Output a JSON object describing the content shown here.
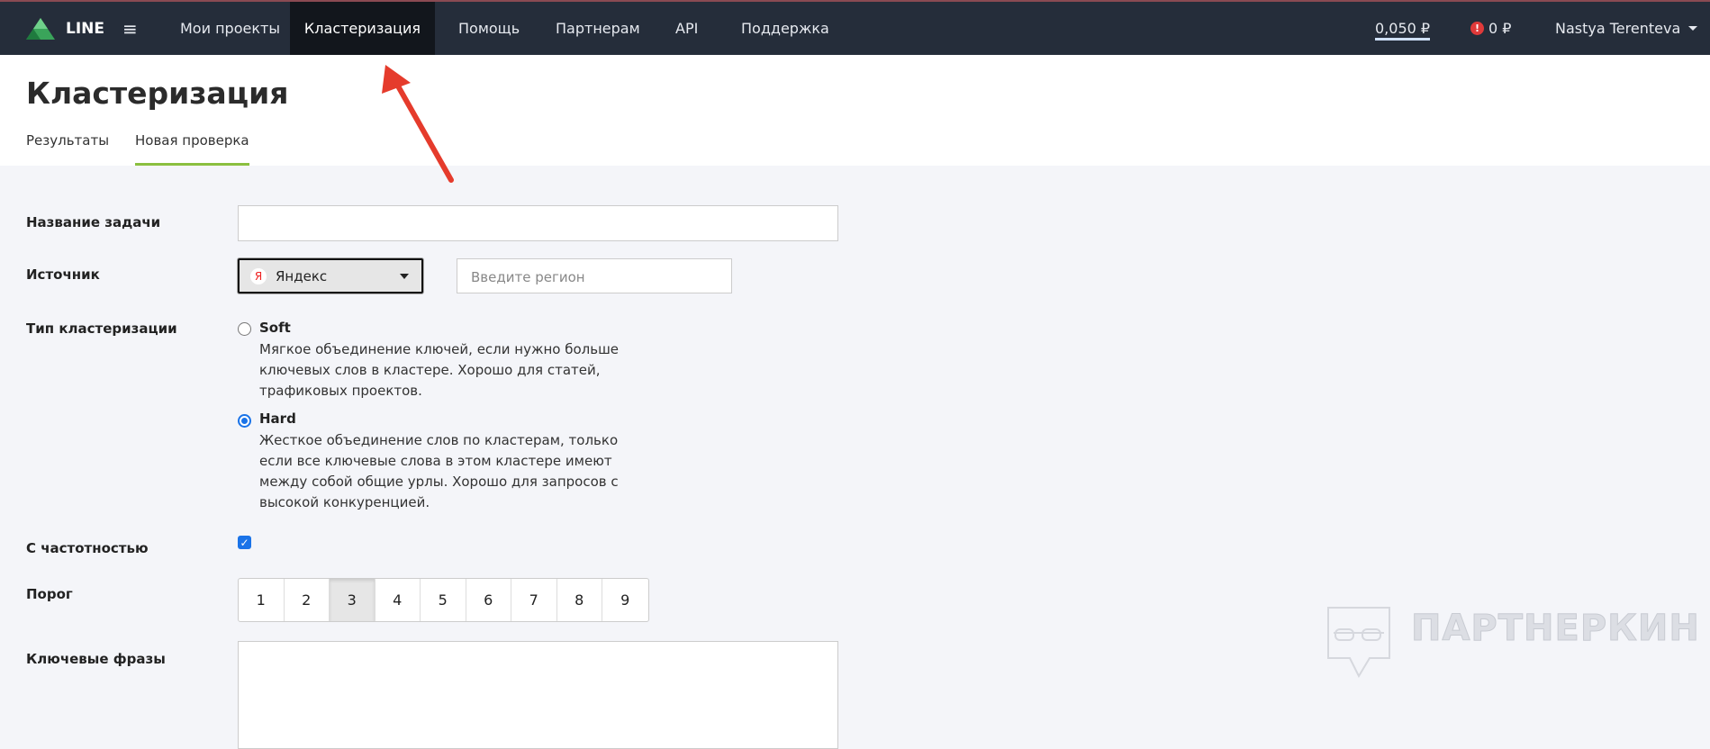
{
  "nav": {
    "logo": "LINE",
    "items": [
      "Мои проекты",
      "Кластеризация",
      "Помощь",
      "Партнерам",
      "API",
      "Поддержка"
    ],
    "active": "Кластеризация",
    "balance": "0,050 ₽",
    "debt": "0 ₽",
    "user": "Nastya Terenteva"
  },
  "page": {
    "title": "Кластеризация",
    "tabs": [
      "Результаты",
      "Новая проверка"
    ],
    "active_tab": "Новая проверка"
  },
  "form": {
    "task_name_label": "Название задачи",
    "task_name_value": "",
    "source_label": "Источник",
    "source_icon": "Я",
    "source_value": "Яндекс",
    "region_placeholder": "Введите регион",
    "type_label": "Тип кластеризации",
    "soft_title": "Soft",
    "soft_desc": "Мягкое объединение ключей, если нужно больше ключевых слов в кластере. Хорошо для статей, трафиковых проектов.",
    "hard_title": "Hard",
    "hard_desc": "Жесткое объединение слов по кластерам, только если все ключевые слова в этом кластере имеют между собой общие урлы. Хорошо для запросов с высокой конкуренцией.",
    "selected_type": "Hard",
    "frequency_label": "С частотностью",
    "frequency_checked": true,
    "threshold_label": "Порог",
    "threshold_options": [
      "1",
      "2",
      "3",
      "4",
      "5",
      "6",
      "7",
      "8",
      "9"
    ],
    "threshold_selected": "3",
    "keywords_label": "Ключевые фразы",
    "keywords_value": ""
  },
  "watermark": "ПАРТНЕРКИН",
  "colors": {
    "nav_bg": "#252d3a",
    "accent_green": "#8bbf3f",
    "arrow": "#e53b2c",
    "radio_blue": "#1a73e8"
  }
}
